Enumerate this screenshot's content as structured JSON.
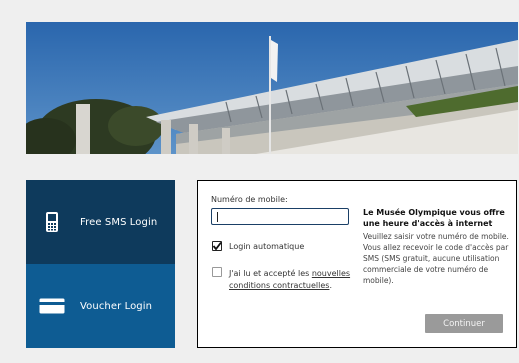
{
  "tabs": {
    "sms_label": "Free SMS Login",
    "voucher_label": "Voucher Login"
  },
  "form": {
    "mobile_label": "Numéro de mobile:",
    "mobile_value": "",
    "auto_login_label": "Login automatique",
    "auto_login_checked": true,
    "terms_prefix": "J'ai lu et accepté les ",
    "terms_link": "nouvelles conditions contractuelles",
    "terms_suffix": ".",
    "terms_checked": false,
    "continue_label": "Continuer"
  },
  "info": {
    "title": "Le Musée Olympique vous offre une heure d'accès à internet",
    "text": "Veuillez saisir votre numéro de mobile. Vous allez recevoir le code d'accès par SMS (SMS gratuit, aucune utilisation commerciale de votre numéro de mobile)."
  },
  "colors": {
    "sms_tab": "#0e3a5c",
    "voucher_tab": "#0e5c93",
    "button": "#9a9a9a"
  },
  "icons": {
    "sms": "mobile-phone-icon",
    "voucher": "credit-card-icon"
  }
}
